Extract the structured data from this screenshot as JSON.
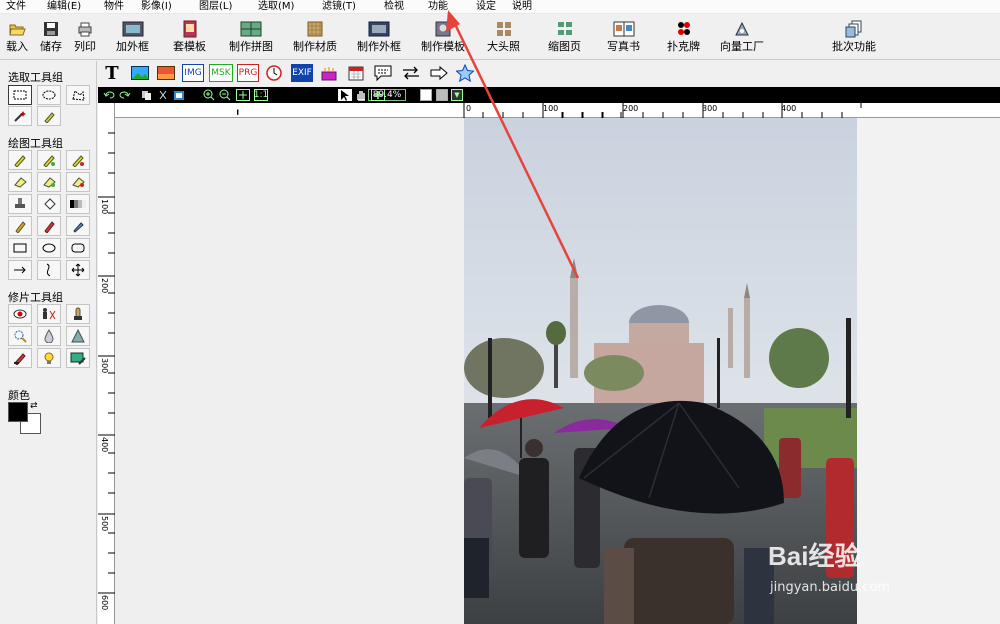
{
  "menu": [
    "文件",
    "编辑(E)",
    "物件",
    "影像(I)",
    "图层(L)",
    "选取(M)",
    "滤镜(T)",
    "检视",
    "功能",
    "设定",
    "说明"
  ],
  "toolbar": {
    "buttons": [
      {
        "label": "载入",
        "icon": "folder-open-icon"
      },
      {
        "label": "储存",
        "icon": "floppy-disk-icon"
      },
      {
        "label": "列印",
        "icon": "printer-icon"
      },
      {
        "label": "加外框",
        "icon": "picture-frame-icon"
      },
      {
        "label": "套模板",
        "icon": "template-icon"
      },
      {
        "label": "制作拼图",
        "icon": "collage-icon"
      },
      {
        "label": "制作材质",
        "icon": "texture-icon"
      },
      {
        "label": "制作外框",
        "icon": "frame-maker-icon"
      },
      {
        "label": "制作模板",
        "icon": "template-maker-icon"
      },
      {
        "label": "大头照",
        "icon": "id-photo-icon"
      },
      {
        "label": "缩图页",
        "icon": "thumbnail-page-icon"
      },
      {
        "label": "写真书",
        "icon": "photo-book-icon"
      },
      {
        "label": "扑克牌",
        "icon": "playing-cards-icon"
      },
      {
        "label": "向量工厂",
        "icon": "vector-factory-icon"
      },
      {
        "label": "批次功能",
        "icon": "batch-icon"
      }
    ]
  },
  "palette": {
    "select_group": "选取工具组",
    "draw_group": "绘图工具组",
    "retouch_group": "修片工具组",
    "color_label": "颜色"
  },
  "toolbar2": {
    "text_tool": "T",
    "img_label": "IMG",
    "msk_label": "MSK",
    "prg_label": "PRG",
    "exif_label": "EXIF"
  },
  "status": {
    "zoom": "89.4%"
  },
  "ruler": {
    "top_ticks": [
      "0",
      "100",
      "200",
      "300",
      "400"
    ],
    "left_ticks": [
      "100",
      "200",
      "300",
      "400",
      "500",
      "600"
    ]
  },
  "watermark": {
    "brand": "Bai经验",
    "url": "jingyan.baidu.com"
  },
  "colors": {
    "arrow": "#e8433a",
    "foreground": "#000000",
    "background": "#ffffff"
  }
}
